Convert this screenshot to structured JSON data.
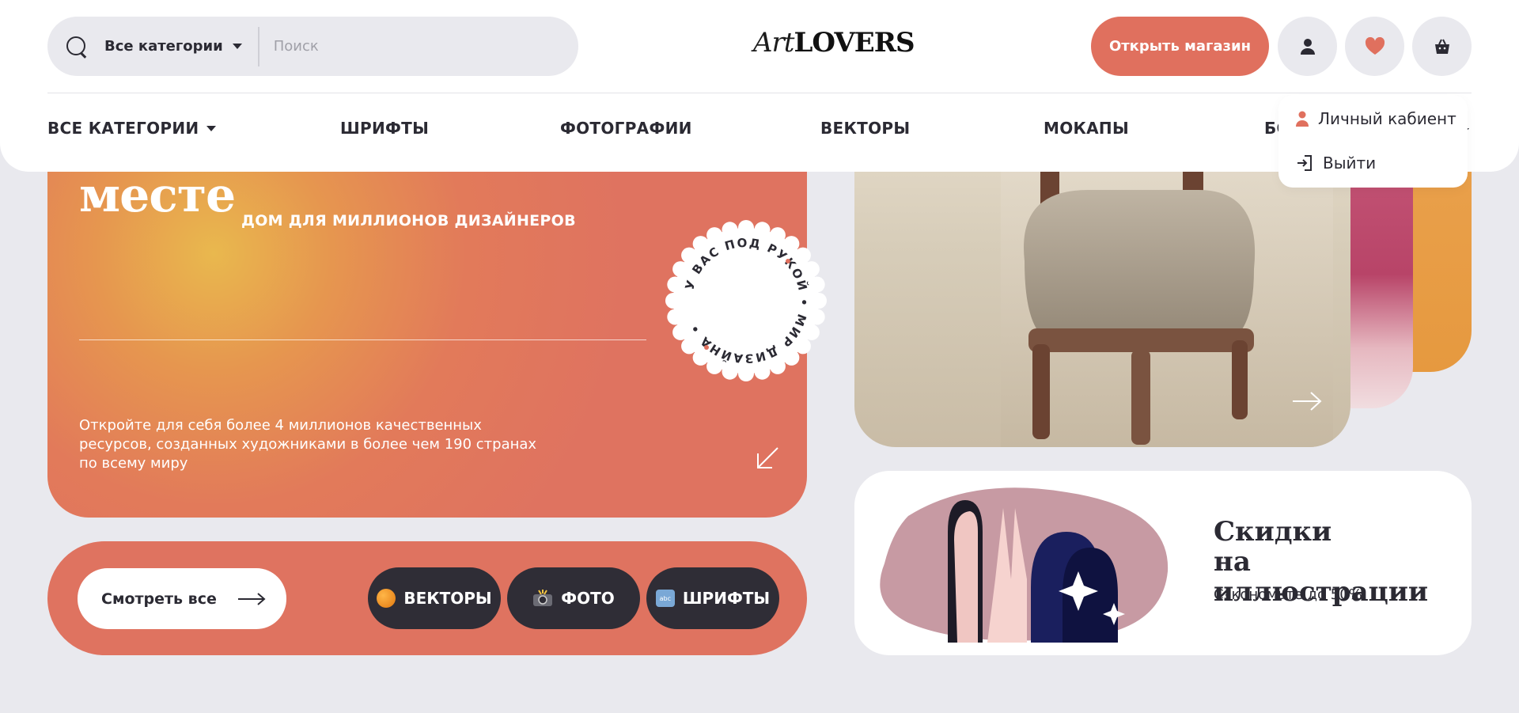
{
  "header": {
    "search": {
      "category_label": "Все категории",
      "placeholder": "Поиск"
    },
    "logo": {
      "script": "Art",
      "bold": "LOVERS"
    },
    "open_shop_label": "Открыть магазин",
    "icons": [
      "user-icon",
      "heart-icon",
      "cart-icon"
    ],
    "accent_color": "#e0705e"
  },
  "nav": {
    "items": [
      {
        "label": "ВСЕ КАТЕГОРИИ"
      },
      {
        "label": "ШРИФТЫ"
      },
      {
        "label": "ФОТОГРАФИИ"
      },
      {
        "label": "ВЕКТОРЫ"
      },
      {
        "label": "МОКАПЫ"
      },
      {
        "label": "БО"
      }
    ]
  },
  "dropdown": {
    "items": [
      {
        "label": "Личный кабиент",
        "icon": "user-icon"
      },
      {
        "label": "Выйти",
        "icon": "logout-icon"
      }
    ]
  },
  "hero": {
    "title": "месте",
    "subtitle": "ДОМ ДЛЯ МИЛЛИОНОВ ДИЗАЙНЕРОВ",
    "description": "Откройте для себя более 4 миллионов качественных ресурсов, созданных художниками в более чем 190 странах по всему миру",
    "stamp_text": "У ВАС ПОД РУКОЙ • МИР ДИЗАЙНА •"
  },
  "bar": {
    "see_all_label": "Смотреть все",
    "chips": [
      {
        "label": "ВЕКТОРЫ",
        "icon": "orange-circle-icon"
      },
      {
        "label": "ФОТО",
        "icon": "camera-flash-icon"
      },
      {
        "label": "ШРИФТЫ",
        "icon": "abc-icon"
      }
    ]
  },
  "sale": {
    "title_line1": "Скидки",
    "title_line2": "на иллюстрации",
    "subtitle": "Сэкономьте до 50%"
  }
}
